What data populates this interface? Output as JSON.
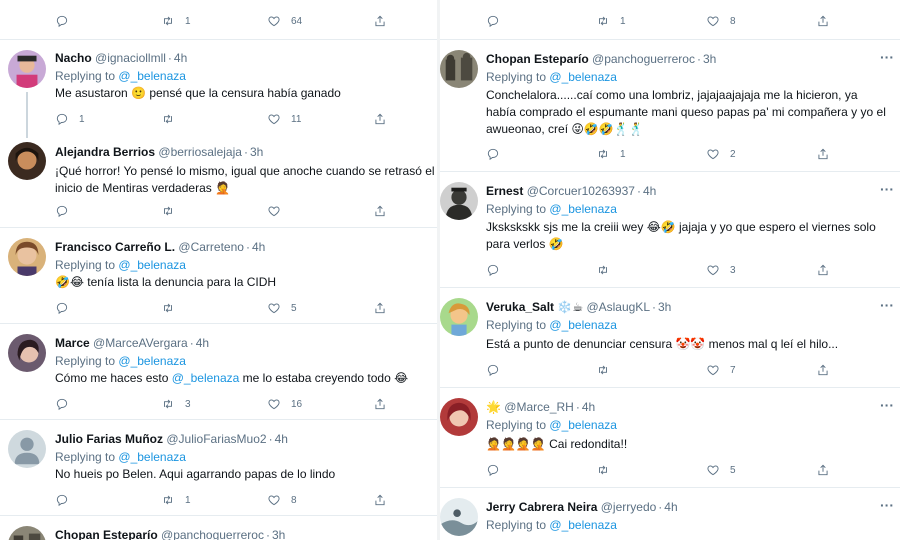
{
  "left": {
    "top_actions": {
      "replies": "",
      "retweets": "1",
      "likes": "64"
    },
    "tweets": [
      {
        "name": "Nacho",
        "handle": "@ignaciollmll",
        "time": "4h",
        "replying_prefix": "Replying to",
        "replying_to": "@_belenaza",
        "text": "Me asustaron 🙂 pensé que la censura había ganado",
        "actions": {
          "replies": "1",
          "retweets": "",
          "likes": "11"
        }
      },
      {
        "name": "Alejandra Berrios",
        "handle": "@berriosalejaja",
        "time": "3h",
        "text_line1": "¡Qué horror! Yo pensé lo mismo, igual que anoche cuando se retrasó el",
        "text_line2": "inicio de Mentiras verdaderas 🤦",
        "actions": {
          "replies": "",
          "retweets": "",
          "likes": ""
        }
      },
      {
        "name": "Francisco Carreño L.",
        "handle": "@Carreteno",
        "time": "4h",
        "replying_prefix": "Replying to",
        "replying_to": "@_belenaza",
        "text": "🤣😂 tenía lista la denuncia para la CIDH",
        "actions": {
          "replies": "",
          "retweets": "",
          "likes": "5"
        }
      },
      {
        "name": "Marce",
        "handle": "@MarceAVergara",
        "time": "4h",
        "replying_prefix": "Replying to",
        "replying_to": "@_belenaza",
        "text_before": "Cómo me haces esto",
        "text_mention": "@_belenaza",
        "text_after": "me lo estaba creyendo todo 😂",
        "actions": {
          "replies": "",
          "retweets": "3",
          "likes": "16"
        }
      },
      {
        "name": "Julio Farias Muñoz",
        "handle": "@JulioFariasMuo2",
        "time": "4h",
        "replying_prefix": "Replying to",
        "replying_to": "@_belenaza",
        "text": "No hueis po Belen. Aqui agarrando papas de lo lindo",
        "actions": {
          "replies": "",
          "retweets": "1",
          "likes": "8"
        }
      },
      {
        "name": "Chopan Esteparío",
        "handle": "@panchoguerreroc",
        "time": "3h"
      }
    ]
  },
  "right": {
    "top_actions": {
      "replies": "",
      "retweets": "1",
      "likes": "8"
    },
    "tweets": [
      {
        "name": "Chopan Esteparío",
        "handle": "@panchoguerreroc",
        "time": "3h",
        "replying_prefix": "Replying to",
        "replying_to": "@_belenaza",
        "text_line1": "Conchelalora......caí como una lombriz,  jajajaajajaja me la hicieron,  ya",
        "text_line2": "había comprado el espumante mani queso papas pa' mi compañera y yo el",
        "text_line3": "awueonao, creí 😜🤣🤣🕺🕺",
        "actions": {
          "replies": "",
          "retweets": "1",
          "likes": "2"
        }
      },
      {
        "name": "Ernest",
        "handle": "@Corcuer10263937",
        "time": "4h",
        "replying_prefix": "Replying to",
        "replying_to": "@_belenaza",
        "text_line1": "Jkskskskk sjs me la creiii wey 😂🤣 jajaja y yo que espero el viernes solo",
        "text_line2": "para verlos 🤣",
        "actions": {
          "replies": "",
          "retweets": "",
          "likes": "3"
        }
      },
      {
        "name": "Veruka_Salt",
        "name_emoji": "❄️☕",
        "handle": "@AslaugKL",
        "time": "3h",
        "replying_prefix": "Replying to",
        "replying_to": "@_belenaza",
        "text": "Está a punto de denunciar censura 🤡🤡 menos mal q leí el hilo...",
        "actions": {
          "replies": "",
          "retweets": "",
          "likes": "7"
        }
      },
      {
        "name": "",
        "name_emoji": "🌟",
        "handle": "@Marce_RH",
        "time": "4h",
        "replying_prefix": "Replying to",
        "replying_to": "@_belenaza",
        "text": "🤦🤦🤦🤦 Cai redondita!!",
        "actions": {
          "replies": "",
          "retweets": "",
          "likes": "5"
        }
      },
      {
        "name": "Jerry Cabrera Neira",
        "handle": "@jerryedo",
        "time": "4h",
        "replying_prefix": "Replying to",
        "replying_to": "@_belenaza"
      }
    ]
  },
  "more_label": "···",
  "colors": {
    "text": "#0f1419",
    "muted": "#5b7083",
    "link": "#1b95e0",
    "border": "#e6ecf0"
  }
}
